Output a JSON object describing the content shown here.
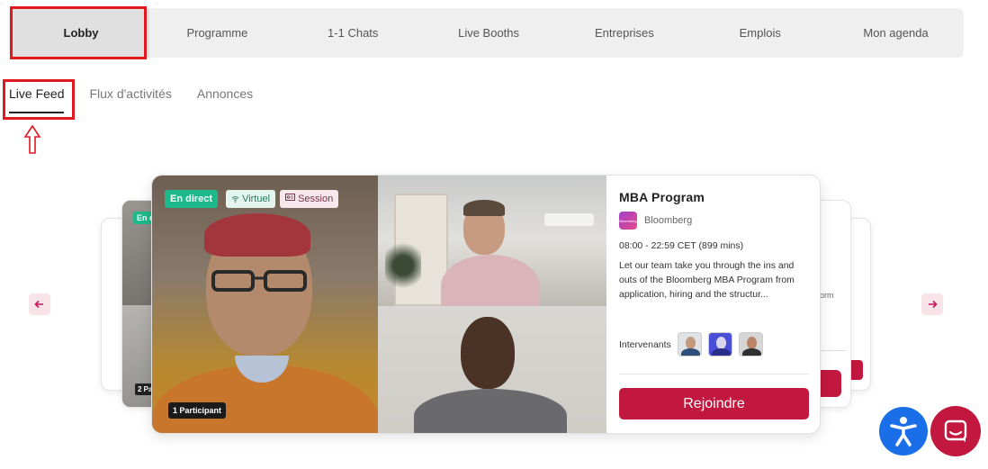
{
  "nav": {
    "tabs": [
      "Lobby",
      "Programme",
      "1-1 Chats",
      "Live Booths",
      "Entreprises",
      "Emplois",
      "Mon agenda"
    ]
  },
  "subtabs": [
    "Live Feed",
    "Flux d'activités",
    "Annonces"
  ],
  "side_cards": {
    "left_live_badge": "En dir",
    "left_participants": "2 Pa",
    "right_fragment": "orm"
  },
  "session": {
    "badges": {
      "live": "En direct",
      "virtual": "Virtuel",
      "session": "Session"
    },
    "participants": "1 Participant",
    "title": "MBA Program",
    "organizer": "Bloomberg",
    "time": "08:00 - 22:59 CET (899 mins)",
    "description": "Let our team take you through the ins and outs of the Bloomberg MBA Program from application, hiring and the structur...",
    "speakers_label": "Intervenants",
    "join_label": "Rejoindre"
  },
  "icons": {
    "prev": "arrow-left-icon",
    "next": "arrow-right-icon",
    "virtual": "wifi-icon",
    "session": "presentation-icon",
    "accessibility": "accessibility-icon",
    "chat": "chat-icon"
  },
  "colors": {
    "accent": "#c2183f",
    "live_green": "#1db98a",
    "a11y_blue": "#1a6fe8",
    "annotation_red": "#e0191e"
  }
}
